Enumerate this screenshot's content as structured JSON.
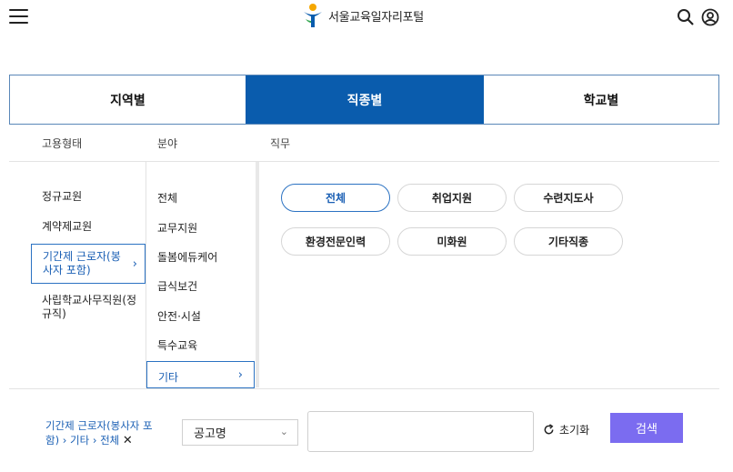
{
  "header": {
    "brand_text": "서울교육일자리포털",
    "menu_icon": "hamburger-menu-icon",
    "search_icon": "search-icon",
    "user_icon": "user-account-icon"
  },
  "tabs": [
    {
      "label": "지역별",
      "active": false
    },
    {
      "label": "직종별",
      "active": true
    },
    {
      "label": "학교별",
      "active": false
    }
  ],
  "columns": {
    "employment_type": "고용형태",
    "field": "분야",
    "duty": "직무"
  },
  "employment_types": [
    {
      "label": "정규교원"
    },
    {
      "label": "계약제교원"
    },
    {
      "label": "기간제 근로자(봉사자 포함)",
      "active": true
    },
    {
      "label": "사립학교사무직원(정규직)"
    }
  ],
  "fields": [
    {
      "label": "전체"
    },
    {
      "label": "교무지원"
    },
    {
      "label": "돌봄에듀케어"
    },
    {
      "label": "급식보건"
    },
    {
      "label": "안전·시설"
    },
    {
      "label": "특수교육"
    },
    {
      "label": "기타",
      "active": true
    }
  ],
  "duties": [
    {
      "label": "전체",
      "active": true
    },
    {
      "label": "취업지원"
    },
    {
      "label": "수련지도사"
    },
    {
      "label": "환경전문인력"
    },
    {
      "label": "미화원"
    },
    {
      "label": "기타직종"
    }
  ],
  "bottom": {
    "crumb_1": "기간제 근로자(봉사자 포함)",
    "crumb_2": "기타",
    "crumb_3": "전체",
    "remove_icon": "close-icon",
    "select_value": "공고명",
    "search_value": "",
    "reset_label": "초기화",
    "search_label": "검색",
    "accent": "#7b6cf0",
    "tab_active_bg": "#0a5cad"
  }
}
